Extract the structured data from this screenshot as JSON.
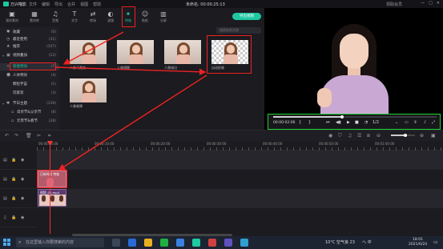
{
  "titlebar": {
    "app_name": "万兴喵影",
    "menu": [
      "文件",
      "编辑",
      "导出",
      "合并",
      "视图",
      "帮助"
    ],
    "project": "未命名: 00:00:25:13",
    "user": "领取会员"
  },
  "toolbar": {
    "tools": [
      {
        "label": "我的素材",
        "icon": "▣"
      },
      {
        "label": "素材库",
        "icon": "▦"
      },
      {
        "label": "音频",
        "icon": "♫"
      },
      {
        "label": "文字",
        "icon": "T"
      },
      {
        "label": "转场",
        "icon": "⇄"
      },
      {
        "label": "滤镜",
        "icon": "◐"
      },
      {
        "label": "特效",
        "icon": "✦"
      },
      {
        "label": "贴纸",
        "icon": "☺"
      },
      {
        "label": "分屏",
        "icon": "▥"
      }
    ],
    "export_label": "导出视频"
  },
  "sidebar": {
    "items": [
      {
        "label": "收藏",
        "count": "(0)",
        "icon": "♥"
      },
      {
        "label": "最近使用",
        "count": "(31)",
        "icon": "◷"
      },
      {
        "label": "推荐",
        "count": "(107)",
        "icon": "★"
      },
      {
        "label": "视频叠加",
        "count": "(12)",
        "icon": "▣",
        "arrow": "▾"
      },
      {
        "label": "智能特效",
        "count": "(7)",
        "icon": "✧"
      },
      {
        "label": "人体特效",
        "count": "(4)",
        "icon": "☻"
      },
      {
        "label": "颗粒宇宙",
        "count": "(1)",
        "icon": ""
      },
      {
        "label": "玩家装",
        "count": "(3)",
        "icon": ""
      },
      {
        "label": "节日主题",
        "count": "(139)",
        "icon": "✱",
        "arrow": "▾"
      },
      {
        "label": "母亲节&父亲节",
        "count": "(8)",
        "icon": "▫"
      },
      {
        "label": "元宵节&春节",
        "count": "(28)",
        "icon": "▫"
      }
    ]
  },
  "effects": {
    "search_placeholder": "搜索贴纸资源",
    "items": [
      {
        "label": "人像马赛克"
      },
      {
        "label": "人像模糊"
      },
      {
        "label": "人像描边"
      },
      {
        "label": "自动抠像"
      },
      {
        "label": "人像故障"
      }
    ]
  },
  "player": {
    "timecode": "00:00:02:06",
    "progress": 0.42,
    "ratio": "1/2",
    "icons": [
      "prev-frame",
      "play",
      "next-frame",
      "stop",
      "volume",
      "ratio",
      "screenshot",
      "snapshot",
      "fullscreen"
    ]
  },
  "timeline": {
    "ruler_labels": [
      "00:00:00:00",
      "00:00:10:00",
      "00:00:20:00",
      "00:00:30:00",
      "00:00:40:00",
      "00:00:50:00",
      "00:01:00:00"
    ],
    "effect_clip_label": "已有时间 特效",
    "video_clip_label": "视频_01.mp4",
    "zoom": 0.6
  },
  "taskbar": {
    "search_placeholder": "在这里输入你要搜索的内容",
    "weather": "10°C 空气良 23",
    "tray": "へ 中",
    "time": "18:01",
    "date": "2021/6/24"
  },
  "colors": {
    "accent": "#1ec8a0",
    "highlight_red": "#e22222",
    "highlight_green": "#22d030"
  }
}
